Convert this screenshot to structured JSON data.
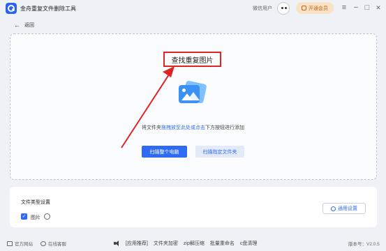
{
  "window": {
    "app_title": "金舟重复文件删除工具",
    "user_name": "微信用户",
    "vip_label": "开通会员",
    "controls": [
      "≡",
      "−",
      "□",
      "✕"
    ]
  },
  "nav": {
    "back_label": "返回"
  },
  "drop_area": {
    "heading": "查找重复图片",
    "hint_prefix": "将文件夹",
    "hint_link": "拖拽放至此处或点击",
    "hint_suffix": "下方按钮进行添加",
    "scan_pc_label": "扫描整个电脑",
    "scan_folder_label": "扫描指定文件夹"
  },
  "annotation": {
    "color": "#e02424"
  },
  "file_types": {
    "title": "文件类型设置",
    "item_label": "图片",
    "item_checked": true,
    "apply_label": "通用设置"
  },
  "footer": {
    "website": "官方网站",
    "support": "在线客服",
    "tools": [
      "[应用推荐]",
      "文件夹加密",
      "zip解压缩",
      "批量重命名",
      "c盘清理"
    ],
    "version": "版本号：V2.0.5"
  },
  "colors": {
    "accent": "#2f6bf2",
    "vip_bg": "#fbe2c4",
    "background": "#eef1f6"
  }
}
